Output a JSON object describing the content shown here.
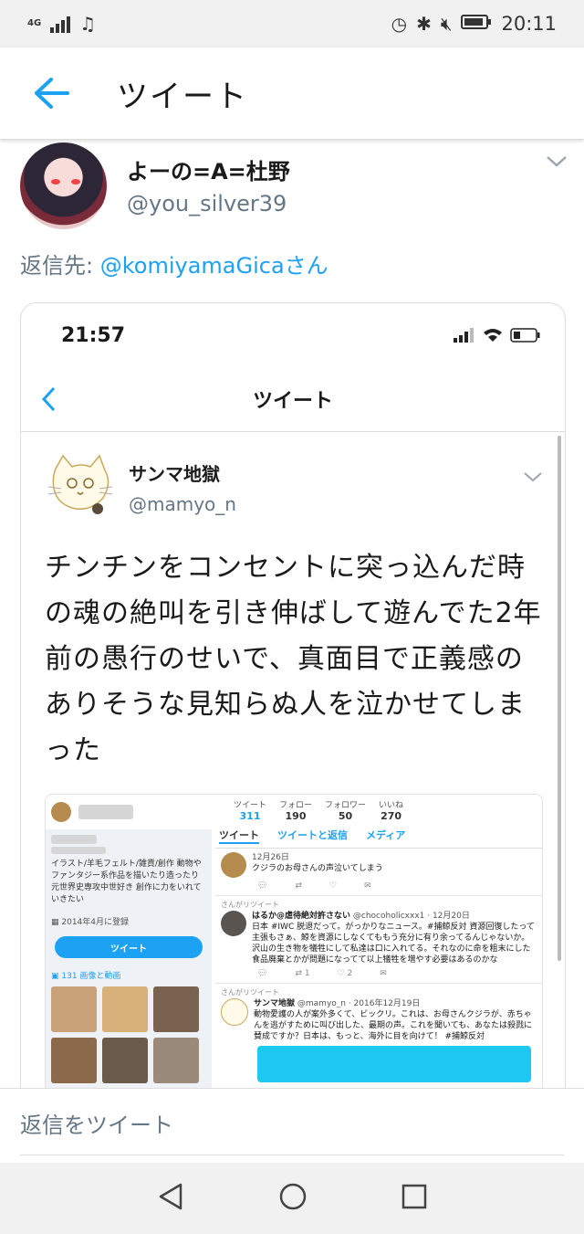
{
  "statusbar": {
    "network": "4G",
    "time": "20:11"
  },
  "appbar": {
    "title": "ツイート"
  },
  "author": {
    "display_name": "よーの=A=杜野",
    "handle": "@you_silver39"
  },
  "reply": {
    "prefix": "返信先: ",
    "user": "@komiyamaGicaさん"
  },
  "screenshot": {
    "time": "21:57",
    "nav_title": "ツイート",
    "tweet": {
      "name": "サンマ地獄",
      "handle": "@mamyo_n",
      "text": "チンチンをコンセントに突っ込んだ時の魂の絶叫を引き伸ばして遊んでた2年前の愚行のせいで、真面目で正義感のありそうな見知らぬ人を泣かせてしまった"
    },
    "nested": {
      "bio": "イラスト/羊毛フェルト/雑貨/創作 動物やファンタジー系作品を描いたり造ったり 元世界史専攻中世好き 創作に力をいれていきたい",
      "joined": "2014年4月に登録",
      "follow_button": "ツイート",
      "media_label": "131 画像と動画",
      "stats": [
        {
          "label": "ツイート",
          "value": "311"
        },
        {
          "label": "フォロー",
          "value": "190"
        },
        {
          "label": "フォロワー",
          "value": "50"
        },
        {
          "label": "いいね",
          "value": "270"
        }
      ],
      "tabs": [
        "ツイート",
        "ツイートと返信",
        "メディア"
      ],
      "t1": {
        "date": "12月26日",
        "text": "クジラのお母さんの声泣いてしまう"
      },
      "t2": {
        "rt": "さんがリツイート",
        "name": "はるか@虐待絶対許さない",
        "handle": "@chocoholicxxx1 · 12月20日",
        "text": "日本 #IWC 脱退だって。がっかりなニュース。#捕鯨反対 資源回復したって主張もさぁ、鯨を資源にしなくてももう充分に有り余ってるんじゃないか。沢山の生き物を犠牲にして私達は口に入れてる。それなのに命を粗末にした食品廃棄とかが問題になってて以上犠牲を増やす必要はあるのかな",
        "rt_count": "1",
        "like_count": "2"
      },
      "t3": {
        "rt": "さんがリツイート",
        "name": "サンマ地獄",
        "handle": "@mamyo_n · 2016年12月19日",
        "text": "動物愛護の人が案外多くて、ビックリ。これは、お母さんクジラが、赤ちゃんを逃がすために叫び出した、最期の声。これを聞いても、あなたは殺戮に賛成ですか？日本は、もっと、海外に目を向けて！ #捕鯨反対"
      }
    }
  },
  "reply_box": {
    "placeholder": "返信をツイート"
  },
  "colors": {
    "accent": "#1da1f2",
    "muted": "#657786"
  }
}
